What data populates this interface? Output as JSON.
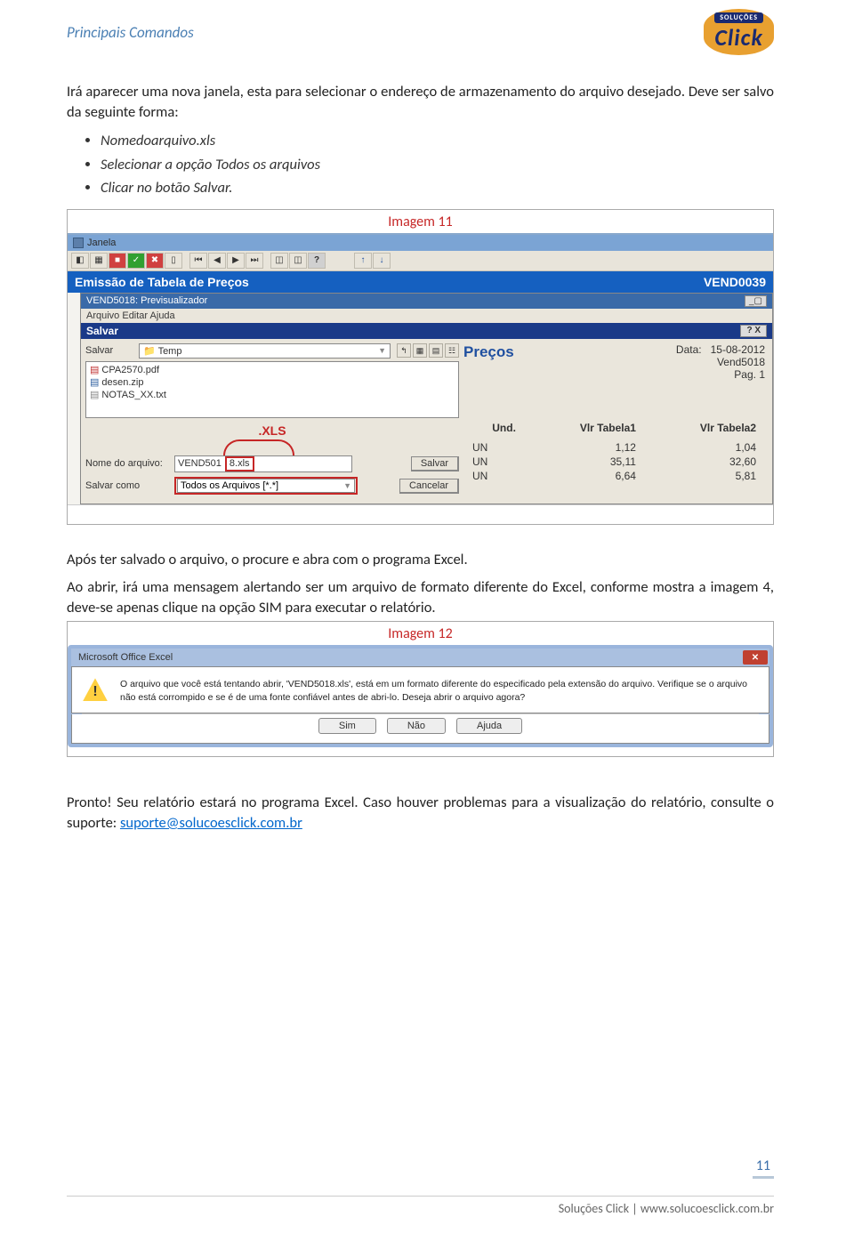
{
  "header": {
    "title": "Principais Comandos",
    "logo_top": "SOLUÇÕES",
    "logo_main": "Click"
  },
  "intro": {
    "p1": "Irá aparecer uma nova janela, esta para selecionar o endereço de armazenamento do arquivo desejado. Deve ser salvo da seguinte forma:",
    "b1": "Nomedoarquivo.xls",
    "b2": "Selecionar a opção Todos os arquivos",
    "b3": "Clicar no botão Salvar."
  },
  "fig11": {
    "label": "Imagem 11",
    "window_name": "Janela",
    "bluebar_left": "Emissão de Tabela de Preços",
    "bluebar_right": "VEND0039",
    "subwin_title": "VEND5018: Previsualizador",
    "submenu": "Arquivo   Editar   Ajuda",
    "save_title": "Salvar",
    "salvar_lbl": "Salvar",
    "folder_value": "Temp",
    "file1": "CPA2570.pdf",
    "file2": "desen.zip",
    "file3": "NOTAS_XX.txt",
    "xls_annotation": ".XLS",
    "nome_lbl": "Nome do arquivo:",
    "nome_value": "VEND501",
    "nome_ext": "8.xls",
    "salvar_btn": "Salvar",
    "como_lbl": "Salvar como",
    "como_value": "Todos os Arquivos [*.*]",
    "cancelar_btn": "Cancelar",
    "precos": "Preços",
    "data_lbl": "Data:",
    "data_val": "15-08-2012",
    "vend": "Vend5018",
    "pag": "Pag. 1",
    "th1": "Und.",
    "th2": "Vlr Tabela1",
    "th3": "Vlr Tabela2",
    "rows": [
      {
        "u": "UN",
        "v1": "1,12",
        "v2": "1,04"
      },
      {
        "u": "UN",
        "v1": "35,11",
        "v2": "32,60"
      },
      {
        "u": "UN",
        "v1": "6,64",
        "v2": "5,81"
      }
    ]
  },
  "mid": {
    "p1": "Após ter salvado o arquivo, o procure e abra com o programa Excel.",
    "p2": "Ao abrir, irá uma mensagem alertando ser um arquivo de formato diferente do Excel, conforme mostra a imagem 4, deve-se apenas clique na opção SIM para executar o relatório."
  },
  "fig12": {
    "label": "Imagem 12",
    "title": "Microsoft Office Excel",
    "msg": "O arquivo que você está tentando abrir, 'VEND5018.xls', está em um formato diferente do especificado pela extensão do arquivo. Verifique se o arquivo não está corrompido e se é de uma fonte confiável antes de abri-lo. Deseja abrir o arquivo agora?",
    "btn_sim": "Sim",
    "btn_nao": "Não",
    "btn_ajuda": "Ajuda"
  },
  "closing": {
    "p_a": "Pronto! Seu relatório estará no programa Excel. Caso houver problemas para a visualização do relatório, consulte o suporte:  ",
    "email": "suporte@solucoesclick.com.br"
  },
  "page_number": "11",
  "footer": "Soluções Click | www.solucoesclick.com.br"
}
